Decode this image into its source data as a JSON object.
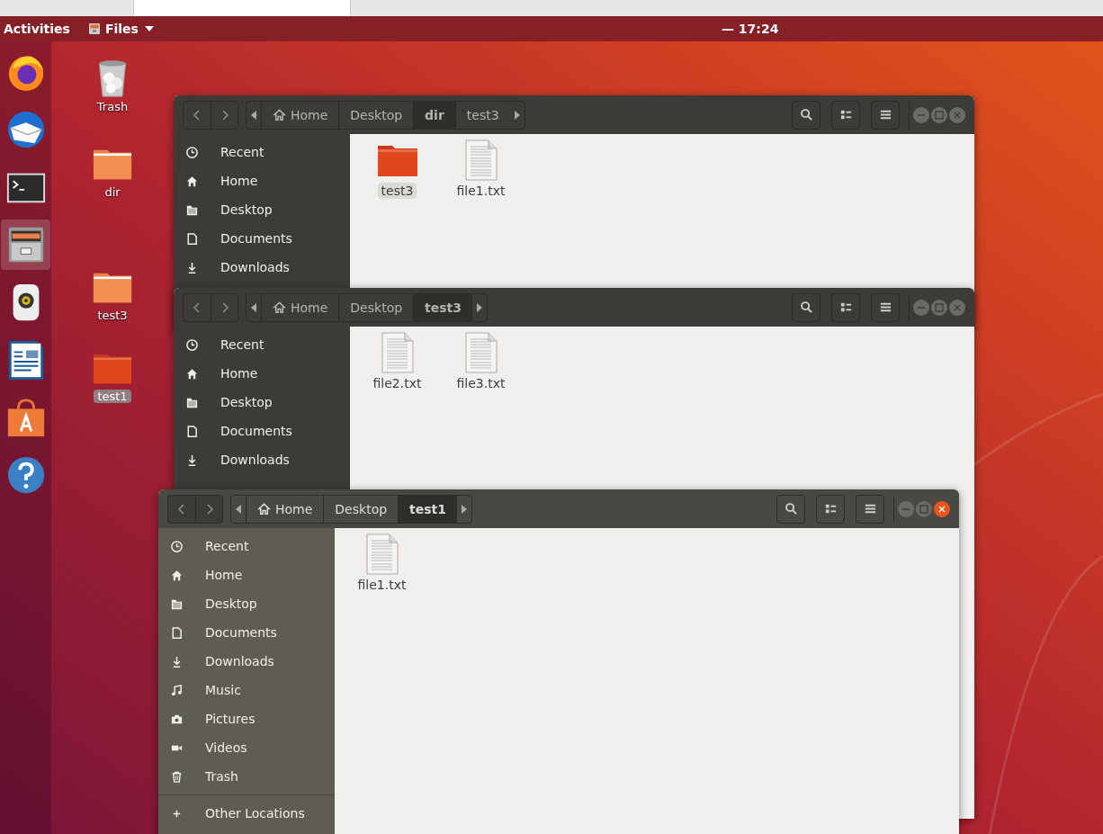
{
  "top_bar": {
    "activities": "Activities",
    "app_menu": "Files",
    "clock": "— 17:24"
  },
  "dock": [
    {
      "kind": "firefox",
      "selected": false
    },
    {
      "kind": "mail",
      "selected": false
    },
    {
      "kind": "terminal",
      "selected": false
    },
    {
      "kind": "files",
      "selected": true
    },
    {
      "kind": "speaker",
      "selected": false
    },
    {
      "kind": "writer",
      "selected": false
    },
    {
      "kind": "store",
      "selected": false
    },
    {
      "kind": "help",
      "selected": false
    }
  ],
  "desktop_icons": [
    {
      "label": "Trash",
      "kind": "trash",
      "selected": false
    },
    {
      "label": "dir",
      "kind": "folder",
      "selected": false
    },
    {
      "label": "test3",
      "kind": "folder",
      "selected": false
    },
    {
      "label": "test1",
      "kind": "folder",
      "selected": true
    }
  ],
  "windows": [
    {
      "active": false,
      "path": [
        {
          "label": "Home",
          "kind": "home",
          "selected": false
        },
        {
          "label": "Desktop",
          "kind": "folder",
          "selected": false
        },
        {
          "label": "dir",
          "kind": "folder",
          "selected": true
        },
        {
          "label": "test3",
          "kind": "folder",
          "selected": false
        }
      ],
      "sidebar": [
        {
          "label": "Recent",
          "kind": "recent"
        },
        {
          "label": "Home",
          "kind": "home"
        },
        {
          "label": "Desktop",
          "kind": "desktop"
        },
        {
          "label": "Documents",
          "kind": "documents"
        },
        {
          "label": "Downloads",
          "kind": "downloads"
        }
      ],
      "files": [
        {
          "name": "test3",
          "kind": "folder",
          "selected": true
        },
        {
          "name": "file1.txt",
          "kind": "text",
          "selected": false
        }
      ]
    },
    {
      "active": false,
      "path": [
        {
          "label": "Home",
          "kind": "home",
          "selected": false
        },
        {
          "label": "Desktop",
          "kind": "folder",
          "selected": false
        },
        {
          "label": "test3",
          "kind": "folder",
          "selected": true
        }
      ],
      "sidebar": [
        {
          "label": "Recent",
          "kind": "recent"
        },
        {
          "label": "Home",
          "kind": "home"
        },
        {
          "label": "Desktop",
          "kind": "desktop"
        },
        {
          "label": "Documents",
          "kind": "documents"
        },
        {
          "label": "Downloads",
          "kind": "downloads"
        }
      ],
      "files": [
        {
          "name": "file2.txt",
          "kind": "text",
          "selected": false
        },
        {
          "name": "file3.txt",
          "kind": "text",
          "selected": false
        }
      ]
    },
    {
      "active": true,
      "path": [
        {
          "label": "Home",
          "kind": "home",
          "selected": false
        },
        {
          "label": "Desktop",
          "kind": "folder",
          "selected": false
        },
        {
          "label": "test1",
          "kind": "folder",
          "selected": true
        }
      ],
      "sidebar": [
        {
          "label": "Recent",
          "kind": "recent"
        },
        {
          "label": "Home",
          "kind": "home"
        },
        {
          "label": "Desktop",
          "kind": "desktop"
        },
        {
          "label": "Documents",
          "kind": "documents"
        },
        {
          "label": "Downloads",
          "kind": "downloads"
        },
        {
          "label": "Music",
          "kind": "music"
        },
        {
          "label": "Pictures",
          "kind": "pictures"
        },
        {
          "label": "Videos",
          "kind": "videos"
        },
        {
          "label": "Trash",
          "kind": "trash"
        },
        {
          "label": "Other Locations",
          "kind": "other"
        }
      ],
      "files": [
        {
          "name": "file1.txt",
          "kind": "text",
          "selected": false
        }
      ]
    }
  ]
}
